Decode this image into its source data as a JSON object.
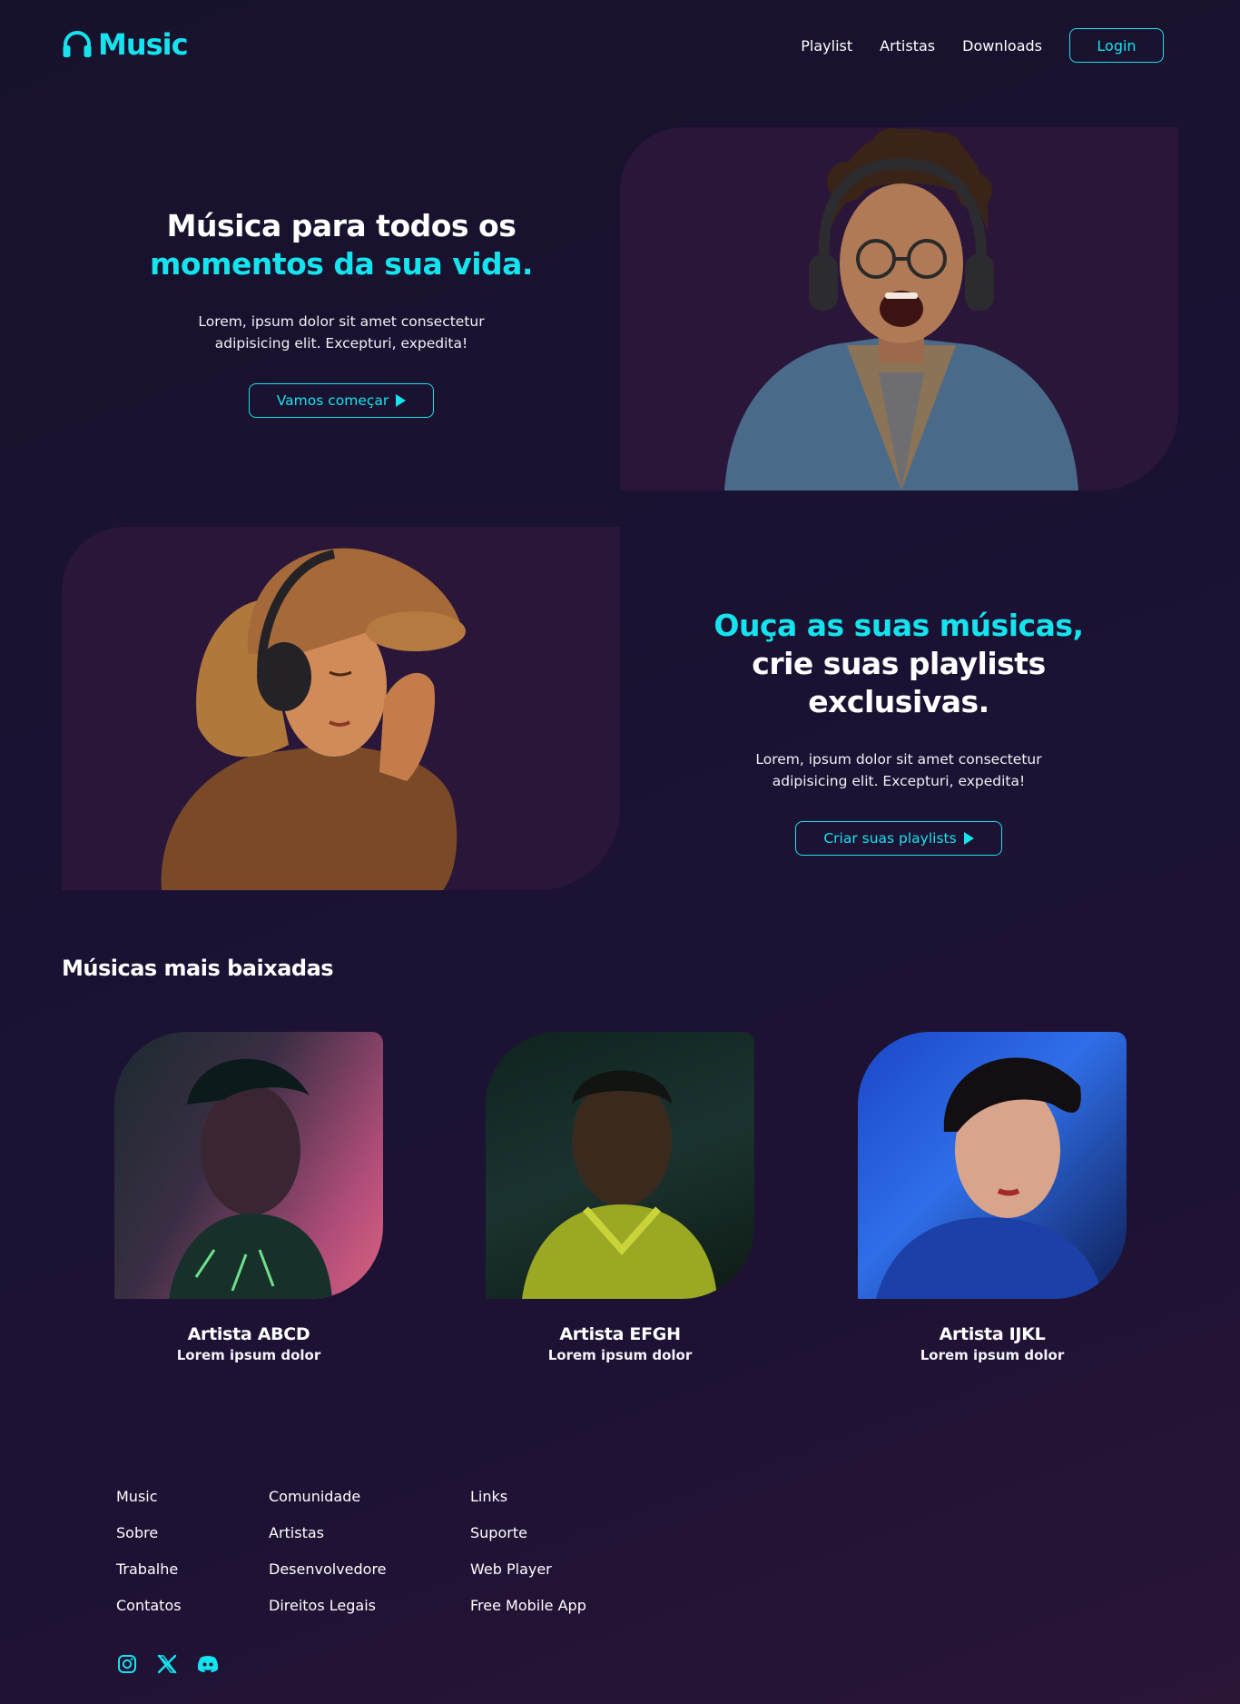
{
  "colors": {
    "accent": "#15e3ee",
    "background": "#1a1230",
    "panel": "#2a1638"
  },
  "nav": {
    "logo": "Music",
    "links": [
      "Playlist",
      "Artistas",
      "Downloads"
    ],
    "login": "Login"
  },
  "hero1": {
    "heading_line1": "Música para todos os",
    "heading_line2": "momentos da sua vida.",
    "para_line1": "Lorem, ipsum dolor sit amet consectetur",
    "para_line2": "adipisicing elit. Excepturi, expedita!",
    "cta": "Vamos começar"
  },
  "hero2": {
    "heading_line1": "Ouça as suas músicas,",
    "heading_line2": "crie suas playlists exclusivas.",
    "para_line1": "Lorem, ipsum dolor sit amet consectetur",
    "para_line2": "adipisicing elit. Excepturi, expedita!",
    "cta": "Criar suas playlists"
  },
  "downloads": {
    "title": "Músicas mais baixadas",
    "cards": [
      {
        "name": "Artista ABCD",
        "subtitle": "Lorem ipsum dolor"
      },
      {
        "name": "Artista EFGH",
        "subtitle": "Lorem ipsum dolor"
      },
      {
        "name": "Artista IJKL",
        "subtitle": "Lorem ipsum dolor"
      }
    ]
  },
  "footer": {
    "col1": [
      "Music",
      "Sobre",
      "Trabalhe",
      "Contatos"
    ],
    "col2": [
      "Comunidade",
      "Artistas",
      "Desenvolvedore",
      "Direitos Legais"
    ],
    "col3": [
      "Links",
      "Suporte",
      "Web Player",
      "Free Mobile App"
    ],
    "socials": [
      "instagram-icon",
      "x-twitter-icon",
      "discord-icon"
    ]
  }
}
